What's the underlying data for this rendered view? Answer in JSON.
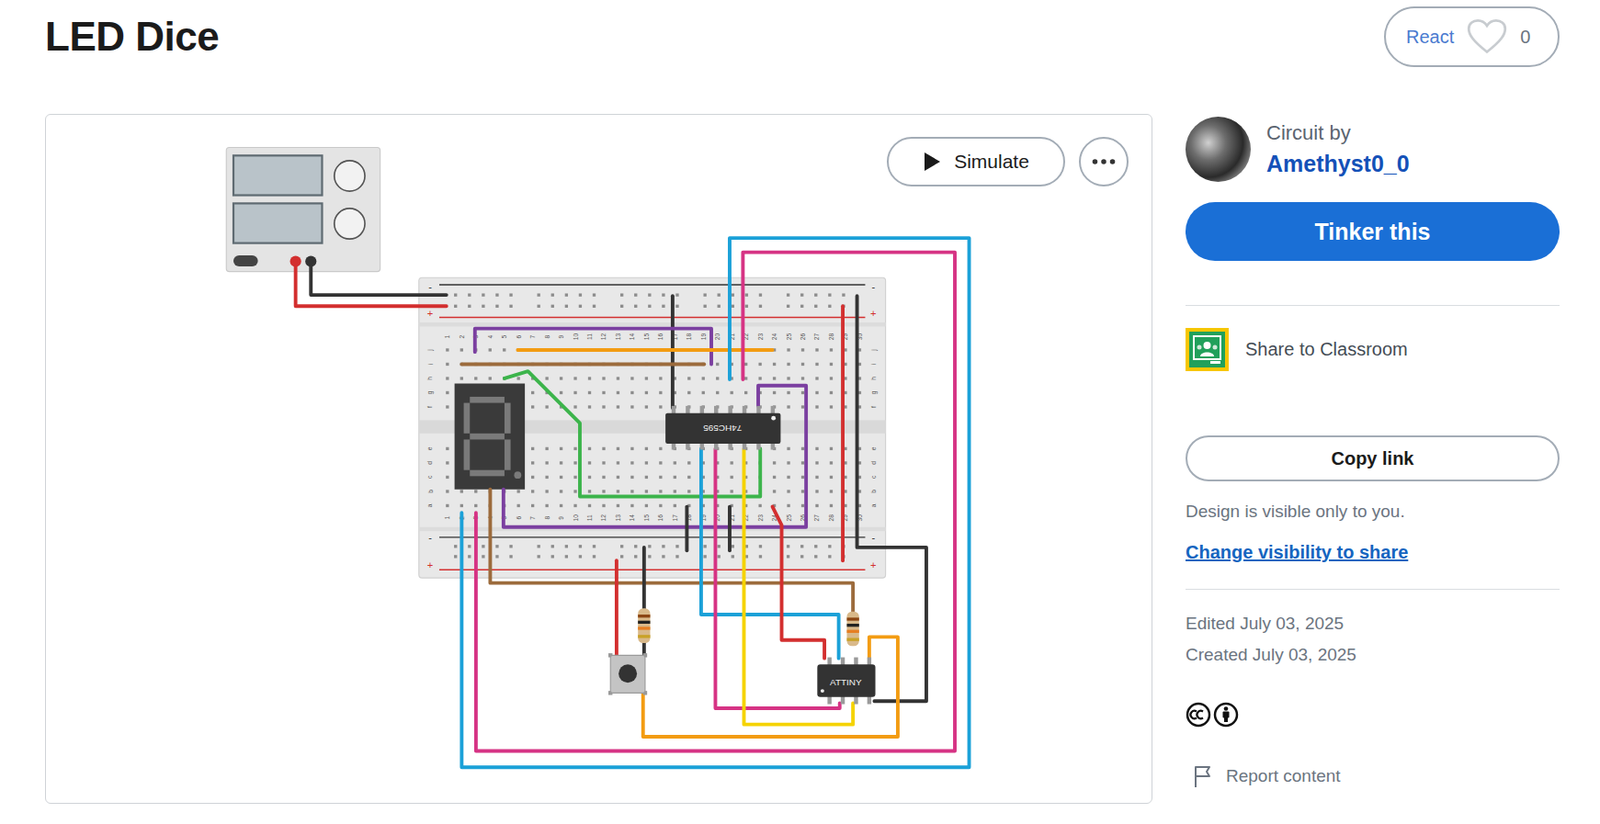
{
  "page": {
    "title": "LED Dice"
  },
  "react": {
    "label": "React",
    "count": "0",
    "reacted": false
  },
  "canvas": {
    "simulate_button": "Simulate",
    "breadboard": {
      "columns": [
        "1",
        "2",
        "3",
        "4",
        "5",
        "6",
        "7",
        "8",
        "9",
        "10",
        "11",
        "12",
        "13",
        "14",
        "15",
        "16",
        "17",
        "18",
        "19",
        "20",
        "21",
        "22",
        "23",
        "24",
        "25",
        "26",
        "27",
        "28",
        "29",
        "30"
      ],
      "rows_top": [
        "j",
        "i",
        "h",
        "g",
        "f"
      ],
      "rows_bottom": [
        "e",
        "d",
        "c",
        "b",
        "a"
      ],
      "rail_labels": [
        "-",
        "+"
      ]
    },
    "chips": [
      {
        "label": "74HC595"
      },
      {
        "label": "ATTINY"
      }
    ]
  },
  "sidebar": {
    "byline": "Circuit by",
    "author": "Amethyst0_0",
    "tinker_button": "Tinker this",
    "share_classroom": "Share to Classroom",
    "copy_link": "Copy link",
    "visibility_note": "Design is visible only to you.",
    "visibility_link": "Change visibility to share",
    "edited": "Edited July 03, 2025",
    "created": "Created July 03, 2025",
    "report": "Report content"
  }
}
